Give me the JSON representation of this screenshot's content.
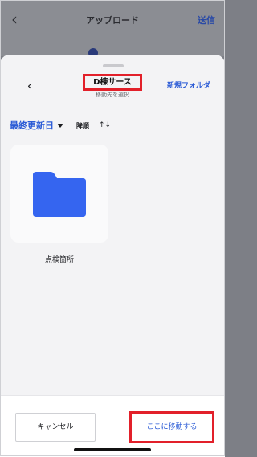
{
  "underlying": {
    "title": "アップロード",
    "send_label": "送信"
  },
  "sheet": {
    "title": "D棟サース",
    "subtitle": "移動先を選択",
    "new_folder_label": "新規フォルダ"
  },
  "sort": {
    "field_label": "最終更新日",
    "order_label": "降順",
    "order_icon": "sort-order-icon"
  },
  "folders": [
    {
      "name": "点検箇所",
      "icon": "folder-icon"
    }
  ],
  "footer": {
    "cancel_label": "キャンセル",
    "move_label": "ここに移動する"
  },
  "colors": {
    "accent": "#2b5bd6",
    "highlight": "#e2202a",
    "folder": "#3565f0"
  }
}
